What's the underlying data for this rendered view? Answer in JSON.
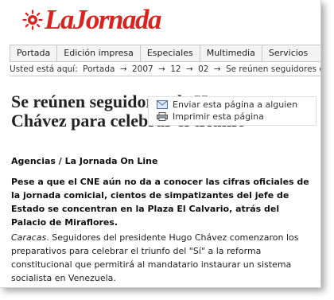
{
  "site": {
    "logo_text": "LaJornada",
    "brand_color": "#d8231f"
  },
  "nav": {
    "items": [
      "Portada",
      "Edición impresa",
      "Especiales",
      "Multimedia",
      "Servicios"
    ]
  },
  "breadcrumb": {
    "prefix": "Usted está aquí:",
    "items": [
      "Portada",
      "2007",
      "12",
      "02",
      "Se reúnen seguidores de"
    ],
    "separator": "→"
  },
  "article": {
    "title": "Se reúnen seguidores de Hugo Chávez para celebrar el triunfo",
    "byline": "Agencias / La Jornada On Line",
    "lead": "Pese a que el CNE aún no da a conocer las cifras oficiales de la jornada comicial, cientos de simpatizantes del jefe de Estado se concentran en la Plaza El Calvario, atrás del Palacio de Miraflores.",
    "dateline": "Caracas",
    "body": ". Seguidores del presidente Hugo Chávez comenzaron los preparativos para celebrar el triunfo del \"Sí\" a la reforma constitucional que permitirá al mandatario instaurar un sistema socialista en Venezuela."
  },
  "tools": {
    "send": "Enviar esta página a alguien",
    "send_icon": "envelope-icon",
    "print": "Imprimir esta página",
    "print_icon": "printer-icon"
  }
}
